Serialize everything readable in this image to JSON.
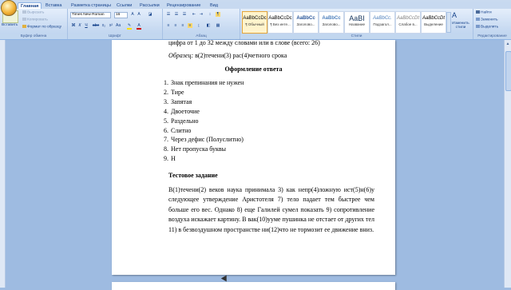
{
  "tabs": [
    "Главная",
    "Вставка",
    "Разметка страницы",
    "Ссылки",
    "Рассылки",
    "Рецензирование",
    "Вид"
  ],
  "clipboard": {
    "paste": "Вставить",
    "cut": "Вырезать",
    "copy": "Копировать",
    "format_painter": "Формат по образцу",
    "group_label": "Буфер обмена"
  },
  "font": {
    "name": "Times New Roman",
    "size": "16",
    "group_label": "Шрифт",
    "buttons": [
      "Ж",
      "К",
      "Ч",
      "abe",
      "x₂",
      "x²",
      "Aa",
      "A"
    ]
  },
  "paragraph": {
    "group_label": "Абзац"
  },
  "styles": {
    "group_label": "Стили",
    "items": [
      {
        "preview": "AaBbCcDc",
        "name": "¶ Обычный"
      },
      {
        "preview": "AaBbCcDc",
        "name": "¶ Без инте..."
      },
      {
        "preview": "AaBbCc",
        "name": "Заголово..."
      },
      {
        "preview": "AaBbCc",
        "name": "Заголово..."
      },
      {
        "preview": "AaBI",
        "name": "Название"
      },
      {
        "preview": "AaBbCc.",
        "name": "Подзагол..."
      },
      {
        "preview": "AaBbCcDt",
        "name": "Слабое в..."
      },
      {
        "preview": "AaBbCcDt",
        "name": "Выделение"
      }
    ],
    "change_styles": "Изменить стили"
  },
  "editing": {
    "find": "Найти",
    "replace": "Заменить",
    "select": "Выделить",
    "group_label": "Редактирование"
  },
  "document": {
    "top_line": "цифра от 1 до 32 между словами или в слове (всего: 26)",
    "example_label": "Образец:",
    "example_text": "в(2)течени(3) рас(4)четного срока",
    "answer_heading": "Оформление ответа",
    "answers": [
      "Знак препинания  не нужен",
      "Тире",
      "Запятая",
      "Двоеточие",
      "Раздельно",
      "Слитно",
      "Через дефис (Полуслитно)",
      "Нет пропуска буквы",
      "Н"
    ],
    "test_heading": "Тестовое задание",
    "test_paragraph": "В(1)течени(2) веков наука принимала 3) как непр(4)ложную ист(5)н(6)у следующее утверждение Аристотеля 7) тело падает тем быстрее чем больше его вес. Однако 8) еще Галилей сумел показать 9) сопротивление воздуха искажает картину. В вак(10)ууме пушинка не отстает от других тел 11) в безвоздушном пространстве ни(12)что не тормозит ее движение вниз."
  },
  "colors": {
    "ribbon": "#c6d9f1",
    "workspace": "#9ebbe1",
    "accent": "#15428b"
  }
}
